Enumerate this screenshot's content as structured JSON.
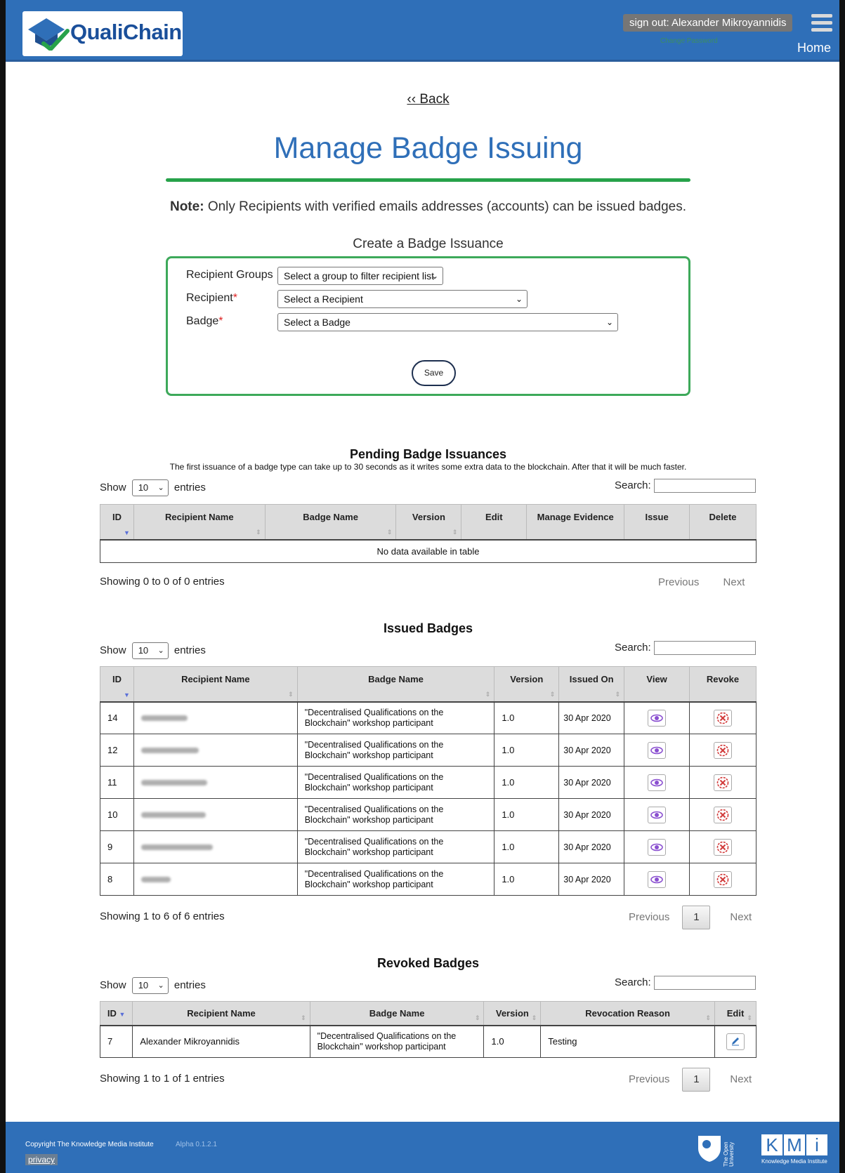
{
  "header": {
    "brand": "QualiChain",
    "signout_label": "sign out: Alexander Mikroyannidis",
    "change_password": "Change Password",
    "home_label": "Home"
  },
  "page": {
    "back_label": "‹‹ Back",
    "title": "Manage Badge Issuing",
    "note_bold": "Note:",
    "note_text": " Only Recipients with verified emails addresses (accounts) can be issued badges."
  },
  "create_form": {
    "title": "Create a Badge Issuance",
    "recipient_groups_label": "Recipient Groups",
    "recipient_groups_value": "Select a group to filter recipient list",
    "recipient_label": "Recipient",
    "recipient_value": "Select a Recipient",
    "badge_label": "Badge",
    "badge_value": "Select a Badge",
    "required_mark": "*",
    "save_label": "Save"
  },
  "pending": {
    "title": "Pending Badge Issuances",
    "subtitle": "The first issuance of a badge type can take up to 30 seconds as it writes some extra data to the blockchain. After that it will be much faster.",
    "show": "Show",
    "entries_value": "10",
    "entries": "entries",
    "search_label": "Search:",
    "columns": [
      "ID",
      "Recipient Name",
      "Badge Name",
      "Version",
      "Edit",
      "Manage Evidence",
      "Issue",
      "Delete"
    ],
    "empty": "No data available in table",
    "info": "Showing 0 to 0 of 0 entries",
    "previous": "Previous",
    "next": "Next"
  },
  "issued": {
    "title": "Issued Badges",
    "show": "Show",
    "entries_value": "10",
    "entries": "entries",
    "search_label": "Search:",
    "columns": [
      "ID",
      "Recipient Name",
      "Badge Name",
      "Version",
      "Issued On",
      "View",
      "Revoke"
    ],
    "rows": [
      {
        "id": "14",
        "badge": "\"Decentralised Qualifications on the Blockchain\" workshop participant",
        "version": "1.0",
        "issued": "30 Apr 2020"
      },
      {
        "id": "12",
        "badge": "\"Decentralised Qualifications on the Blockchain\" workshop participant",
        "version": "1.0",
        "issued": "30 Apr 2020"
      },
      {
        "id": "11",
        "badge": "\"Decentralised Qualifications on the Blockchain\" workshop participant",
        "version": "1.0",
        "issued": "30 Apr 2020"
      },
      {
        "id": "10",
        "badge": "\"Decentralised Qualifications on the Blockchain\" workshop participant",
        "version": "1.0",
        "issued": "30 Apr 2020"
      },
      {
        "id": "9",
        "badge": "\"Decentralised Qualifications on the Blockchain\" workshop participant",
        "version": "1.0",
        "issued": "30 Apr 2020"
      },
      {
        "id": "8",
        "badge": "\"Decentralised Qualifications on the Blockchain\" workshop participant",
        "version": "1.0",
        "issued": "30 Apr 2020"
      }
    ],
    "info": "Showing 1 to 6 of 6 entries",
    "previous": "Previous",
    "page": "1",
    "next": "Next"
  },
  "revoked": {
    "title": "Revoked Badges",
    "show": "Show",
    "entries_value": "10",
    "entries": "entries",
    "search_label": "Search:",
    "columns": [
      "ID",
      "Recipient Name",
      "Badge Name",
      "Version",
      "Revocation Reason",
      "Edit"
    ],
    "rows": [
      {
        "id": "7",
        "recipient": "Alexander Mikroyannidis",
        "badge": "\"Decentralised Qualifications on the Blockchain\" workshop participant",
        "version": "1.0",
        "reason": "Testing"
      }
    ],
    "info": "Showing 1 to 1 of 1 entries",
    "previous": "Previous",
    "page": "1",
    "next": "Next"
  },
  "footer": {
    "copyright": "Copyright The Knowledge Media Institute",
    "version": "Alpha 0.1.2.1",
    "privacy": "privacy",
    "ou_text": "The Open University",
    "kmi_letters": [
      "K",
      "M",
      "i"
    ],
    "kmi_sub": "Knowledge Media Institute"
  },
  "colors": {
    "header_blue": "#2f6fb8",
    "accent_green": "#27a24a",
    "view_icon": "#8a4fd0",
    "revoke_icon": "#d23a3a"
  }
}
